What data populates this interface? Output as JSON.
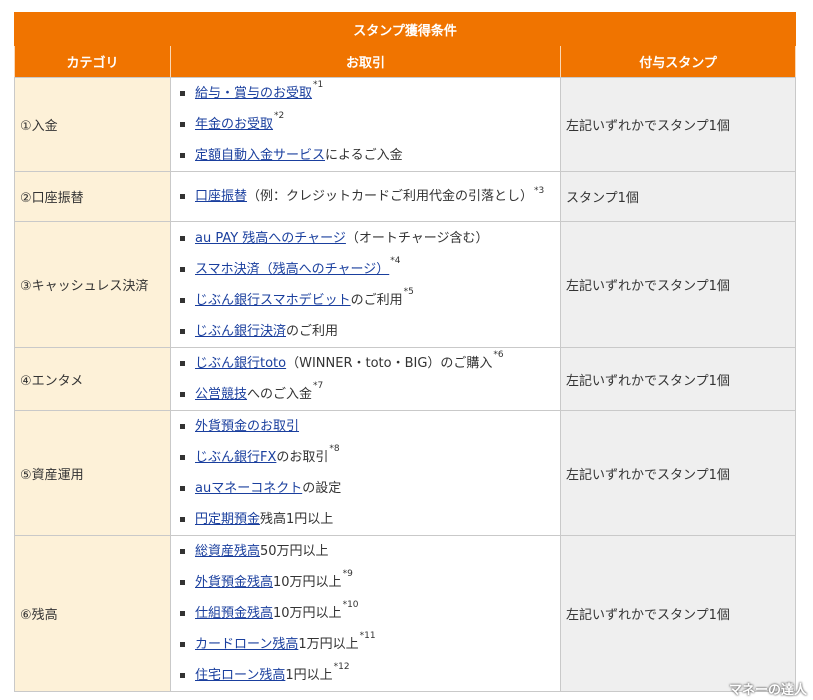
{
  "table": {
    "title": "スタンプ獲得条件",
    "headers": [
      "カテゴリ",
      "お取引",
      "付与スタンプ"
    ],
    "rows": [
      {
        "category": "①入金",
        "items": [
          {
            "link": "給与・賞与のお受取",
            "rest": "",
            "note": "*1"
          },
          {
            "link": "年金のお受取",
            "rest": "",
            "note": "*2"
          },
          {
            "link": "定額自動入金サービス",
            "rest": "によるご入金",
            "note": ""
          }
        ],
        "stamp": "左記いずれかでスタンプ1個"
      },
      {
        "category": "②口座振替",
        "items": [
          {
            "link": "口座振替",
            "rest": "（例：クレジットカードご利用代金の引落とし）",
            "note": "*3"
          }
        ],
        "stamp": "スタンプ1個"
      },
      {
        "category": "③キャッシュレス決済",
        "items": [
          {
            "link": "au PAY 残高へのチャージ",
            "rest": "（オートチャージ含む）",
            "note": ""
          },
          {
            "link": "スマホ決済（残高へのチャージ）",
            "rest": "",
            "note": "*4"
          },
          {
            "link": "じぶん銀行スマホデビット",
            "rest": "のご利用",
            "note": "*5"
          },
          {
            "link": "じぶん銀行決済",
            "rest": "のご利用",
            "note": ""
          }
        ],
        "stamp": "左記いずれかでスタンプ1個"
      },
      {
        "category": "④エンタメ",
        "items": [
          {
            "link": "じぶん銀行toto",
            "rest": "（WINNER・toto・BIG）のご購入",
            "note": "*6"
          },
          {
            "link": "公営競技",
            "rest": "へのご入金",
            "note": "*7"
          }
        ],
        "stamp": "左記いずれかでスタンプ1個"
      },
      {
        "category": "⑤資産運用",
        "items": [
          {
            "link": "外貨預金のお取引",
            "rest": "",
            "note": ""
          },
          {
            "link": "じぶん銀行FX",
            "rest": "のお取引",
            "note": "*8"
          },
          {
            "link": "auマネーコネクト",
            "rest": "の設定",
            "note": ""
          },
          {
            "link": "円定期預金",
            "rest": "残高1円以上",
            "note": ""
          }
        ],
        "stamp": "左記いずれかでスタンプ1個"
      },
      {
        "category": "⑥残高",
        "items": [
          {
            "link": "総資産残高",
            "rest": "50万円以上",
            "note": ""
          },
          {
            "link": "外貨預金残高",
            "rest": "10万円以上",
            "note": "*9"
          },
          {
            "link": "仕組預金残高",
            "rest": "10万円以上",
            "note": "*10"
          },
          {
            "link": "カードローン残高",
            "rest": "1万円以上",
            "note": "*11"
          },
          {
            "link": "住宅ローン残高",
            "rest": "1円以上",
            "note": "*12"
          }
        ],
        "stamp": "左記いずれかでスタンプ1個"
      }
    ]
  },
  "watermark": "マネーの達人",
  "colors": {
    "header": "#f07400",
    "category_bg": "#fdf1d8",
    "stamp_bg": "#efefef",
    "link": "#1a3f9e"
  }
}
